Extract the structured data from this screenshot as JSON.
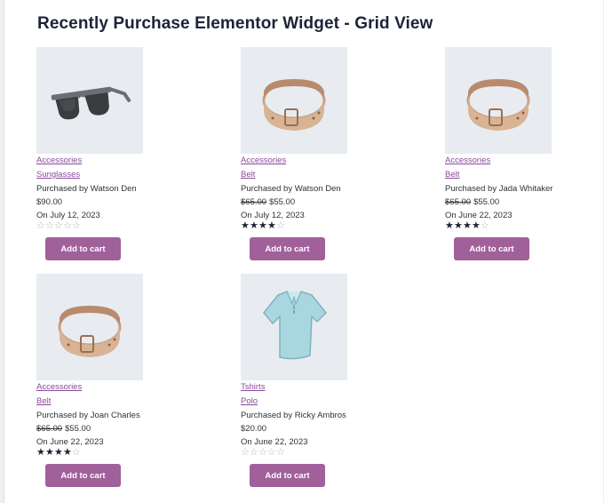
{
  "widget": {
    "title": "Recently Purchase Elementor Widget - Grid View"
  },
  "products": [
    {
      "icon": "sunglasses-image",
      "category": "Accessories",
      "name": "Sunglasses",
      "purchased_by": "Purchased by Watson Den",
      "old_price": "",
      "price": "$90.00",
      "date": "On July 12, 2023",
      "rating": 0,
      "button_label": "Add to cart"
    },
    {
      "icon": "belt-image",
      "category": "Accessories",
      "name": "Belt",
      "purchased_by": "Purchased by Watson Den",
      "old_price": "$65.00",
      "price": "$55.00",
      "date": "On July 12, 2023",
      "rating": 4,
      "button_label": "Add to cart"
    },
    {
      "icon": "belt-image",
      "category": "Accessories",
      "name": "Belt",
      "purchased_by": "Purchased by Jada Whitaker",
      "old_price": "$65.00",
      "price": "$55.00",
      "date": "On June 22, 2023",
      "rating": 4,
      "button_label": "Add to cart"
    },
    {
      "icon": "belt-image",
      "category": "Accessories",
      "name": "Belt",
      "purchased_by": "Purchased by Joan Charles",
      "old_price": "$65.00",
      "price": "$55.00",
      "date": "On June 22, 2023",
      "rating": 4,
      "button_label": "Add to cart"
    },
    {
      "icon": "polo-shirt-image",
      "category": "Tshirts",
      "name": "Polo",
      "purchased_by": "Purchased by Ricky Ambros",
      "old_price": "",
      "price": "$20.00",
      "date": "On June 22, 2023",
      "rating": 0,
      "button_label": "Add to cart"
    }
  ],
  "colors": {
    "link": "#8a4b9b",
    "button": "#a0609a",
    "thumb_bg": "#e8ecf1"
  }
}
